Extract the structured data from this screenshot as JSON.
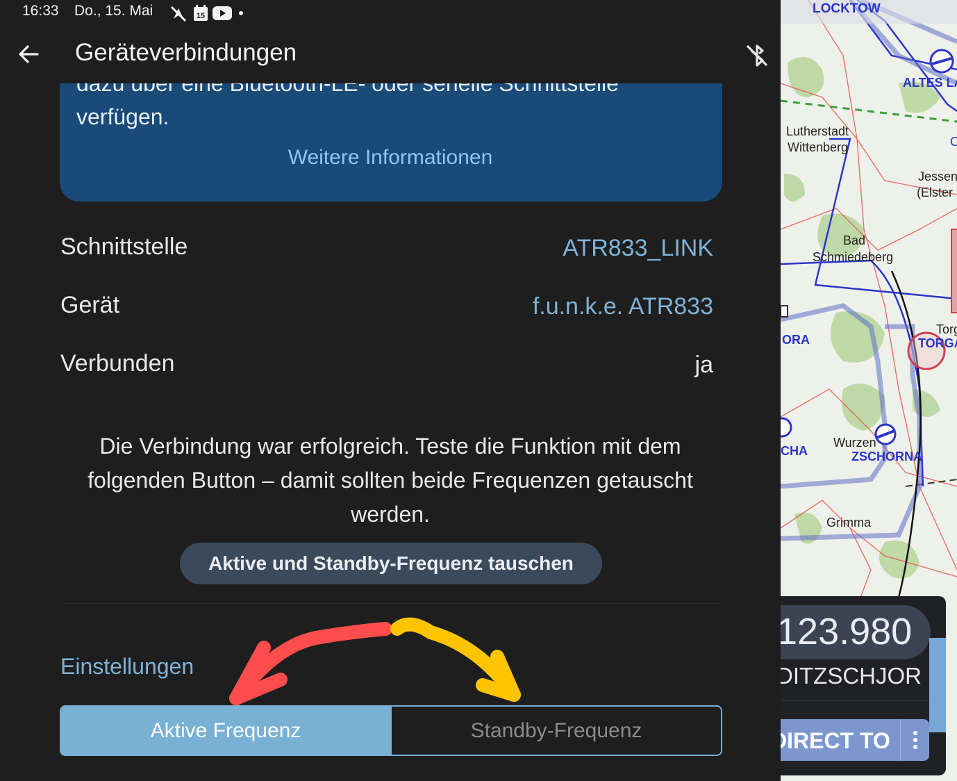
{
  "status_bar": {
    "time": "16:33",
    "date": "Do., 15. Mai",
    "calendar_day": "15",
    "icons": [
      "no-location-icon",
      "calendar-icon",
      "youtube-icon",
      "dot-icon"
    ]
  },
  "app_bar": {
    "title": "Geräteverbindungen",
    "back_icon": "arrow-left-icon",
    "action_icon": "bluetooth-off-icon"
  },
  "info_card": {
    "clipped_text": "dazu über eine Bluetooth-LE- oder serielle Schnittstelle",
    "text_line2": "verfügen.",
    "link": "Weitere Informationen",
    "color": "#1a4a77"
  },
  "rows": [
    {
      "label": "Schnittstelle",
      "value": "ATR833_LINK"
    },
    {
      "label": "Gerät",
      "value": "f.u.n.k.e. ATR833"
    },
    {
      "label": "Verbunden",
      "value": "ja"
    }
  ],
  "message": "Die Verbindung war erfolgreich. Teste die Funktion mit dem folgenden Button – damit sollten beide Frequenzen getauscht werden.",
  "swap_button": "Aktive und Standby-Frequenz tauschen",
  "settings": {
    "title": "Einstellungen",
    "segments": [
      "Aktive Frequenz",
      "Standby-Frequenz"
    ],
    "selected": 0
  },
  "annotations": {
    "red_arrow_color": "#ff4d4d",
    "yellow_arrow_color": "#ffc400"
  },
  "map": {
    "labels": [
      "LOCKTOW",
      "ALTES LA",
      "Lutherstadt",
      "Wittenberg",
      "Jessen",
      "(Elster",
      "Bad",
      "Schmiedeberg",
      "ORA",
      "Torg",
      "TORGA",
      "CHA",
      "Wurzen",
      "ZSCHORNA",
      "Grimma",
      "C"
    ]
  },
  "frequency_widget": {
    "frequency": "123.980",
    "station": "DITZSCHJOR",
    "direct_to": "DIRECT TO",
    "accent": "#7b97ce"
  }
}
